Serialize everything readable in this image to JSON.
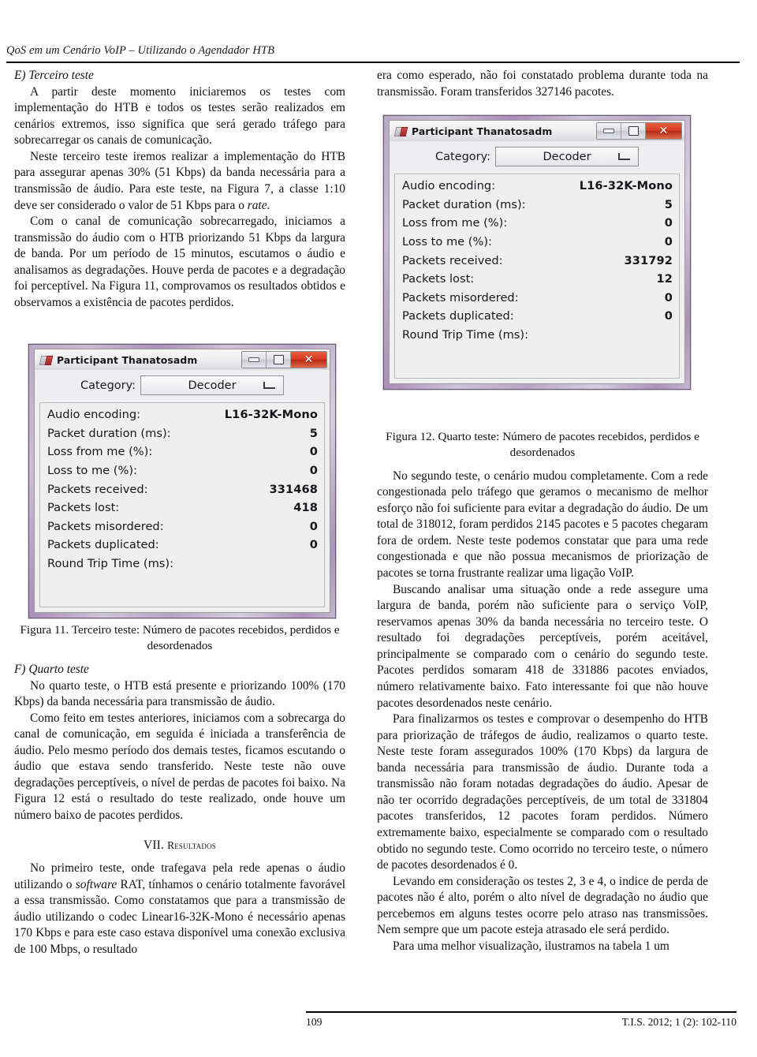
{
  "running_head": "QoS em um Cenário VoIP – Utilizando o Agendador HTB",
  "left_column": {
    "section_e_heading": "E) Terceiro teste",
    "p1": "A partir deste momento iniciaremos os testes com implementação do HTB e todos os testes serão realizados em cenários extremos, isso significa que será gerado tráfego para sobrecarregar os canais de comunicação.",
    "p2_a": "Neste terceiro teste iremos realizar a implementação do HTB para assegurar apenas 30% (51 Kbps) da banda necessária para a transmissão de áudio. Para este teste, na Figura 7, a classe 1:10 deve ser considerado o valor de 51 Kbps para o ",
    "p2_italic": "rate",
    "p2_b": ".",
    "p3": "Com o canal de comunicação sobrecarregado, iniciamos a transmissão do áudio com o HTB priorizando 51 Kbps da largura de banda. Por um período de 15 minutos, escutamos o áudio e analisamos as degradações. Houve perda de pacotes e a degradação foi perceptível. Na Figura 11, comprovamos os resultados obtidos e observamos a existência de pacotes perdidos.",
    "figure11_caption": "Figura 11. Terceiro teste: Número de pacotes recebidos, perdidos e desordenados",
    "section_f_heading": "F) Quarto teste",
    "p4": "No quarto teste, o HTB está presente e priorizando 100% (170 Kbps) da banda necessária para transmissão de áudio.",
    "p5": "Como feito em testes anteriores, iniciamos com a sobrecarga do canal de comunicação, em seguida é iniciada a transferência de áudio. Pelo mesmo período dos demais testes, ficamos escutando o áudio que estava sendo transferido. Neste teste não ouve degradações perceptíveis, o nível de perdas de pacotes foi baixo. Na Figura 12 está o resultado do teste realizado, onde houve um número baixo de pacotes perdidos.",
    "section_vii_number": "VII.",
    "section_vii_title": "Resultados",
    "p6_a": "No primeiro teste, onde trafegava pela rede apenas o áudio utilizando o ",
    "p6_italic": "software",
    "p6_b": " RAT, tínhamos o cenário totalmente favorável a essa transmissão. Como constatamos que para a transmissão de áudio utilizando o codec Linear16-32K-Mono é necessário apenas 170 Kbps e para este caso estava disponível uma conexão exclusiva de 100 Mbps, o resultado"
  },
  "right_column": {
    "p0": "era como esperado, não foi constatado problema durante toda na transmissão. Foram transferidos 327146 pacotes.",
    "figure12_caption": "Figura 12. Quarto teste: Número de pacotes recebidos, perdidos e desordenados",
    "p1": "No segundo teste, o cenário mudou completamente. Com a rede congestionada pelo tráfego que geramos o mecanismo de melhor esforço não foi suficiente para evitar a degradação do áudio. De um total de 318012, foram perdidos 2145 pacotes e 5 pacotes chegaram fora de ordem. Neste teste podemos constatar que para uma rede congestionada e que não possua mecanismos de priorização de pacotes se torna frustrante realizar uma ligação VoIP.",
    "p2": "Buscando analisar uma situação onde a rede assegure uma largura de banda, porém não suficiente para o serviço VoIP, reservamos apenas 30% da banda necessária no terceiro teste. O resultado foi degradações perceptíveis, porém aceitável, principalmente se comparado com o cenário do segundo teste. Pacotes perdidos somaram 418 de 331886 pacotes enviados, número relativamente baixo. Fato interessante foi que não houve pacotes desordenados neste cenário.",
    "p3": "Para finalizarmos os testes e comprovar o desempenho do HTB para priorização de tráfegos de áudio, realizamos o quarto teste. Neste teste foram assegurados 100% (170 Kbps) da largura de banda necessária para transmissão de áudio. Durante toda a transmissão não foram notadas degradações do áudio. Apesar de não ter ocorrido degradações perceptíveis, de um total de 331804 pacotes transferidos, 12 pacotes foram perdidos. Número extremamente baixo, especialmente se comparado com o resultado obtido no segundo teste. Como ocorrido no terceiro teste, o número de pacotes desordenados é 0.",
    "p4": "Levando em consideração os testes 2, 3 e 4, o indice de perda de pacotes não é alto, porém o alto nível de degradação no áudio que percebemos em alguns testes ocorre pelo atraso nas transmissões. Nem sempre que um pacote esteja atrasado ele será perdido.",
    "p5": "Para uma melhor visualização, ilustramos na tabela 1 um"
  },
  "figure11_window": {
    "title": "Participant Thanatosadm",
    "window_icon": "rat-app-icon",
    "minimize_label": "minimize",
    "maximize_label": "maximize",
    "close_label": "✕",
    "category_label": "Category:",
    "category_value": "Decoder",
    "rows": [
      {
        "key": "Audio encoding:",
        "value": "L16-32K-Mono"
      },
      {
        "key": "Packet duration (ms):",
        "value": "5"
      },
      {
        "key": "Loss from me (%):",
        "value": "0"
      },
      {
        "key": "Loss to me (%):",
        "value": "0"
      },
      {
        "key": "Packets received:",
        "value": "331468"
      },
      {
        "key": "Packets lost:",
        "value": "418"
      },
      {
        "key": "Packets misordered:",
        "value": "0"
      },
      {
        "key": "Packets duplicated:",
        "value": "0"
      },
      {
        "key": "Round Trip Time (ms):",
        "value": ""
      }
    ]
  },
  "figure12_window": {
    "title": "Participant Thanatosadm",
    "window_icon": "rat-app-icon",
    "minimize_label": "minimize",
    "maximize_label": "maximize",
    "close_label": "✕",
    "category_label": "Category:",
    "category_value": "Decoder",
    "rows": [
      {
        "key": "Audio encoding:",
        "value": "L16-32K-Mono"
      },
      {
        "key": "Packet duration (ms):",
        "value": "5"
      },
      {
        "key": "Loss from me (%):",
        "value": "0"
      },
      {
        "key": "Loss to me (%):",
        "value": "0"
      },
      {
        "key": "Packets received:",
        "value": "331792"
      },
      {
        "key": "Packets lost:",
        "value": "12"
      },
      {
        "key": "Packets misordered:",
        "value": "0"
      },
      {
        "key": "Packets duplicated:",
        "value": "0"
      },
      {
        "key": "Round Trip Time (ms):",
        "value": ""
      }
    ]
  },
  "footer": {
    "page_number": "109",
    "citation": "T.I.S. 2012; 1 (2): 102-110"
  }
}
